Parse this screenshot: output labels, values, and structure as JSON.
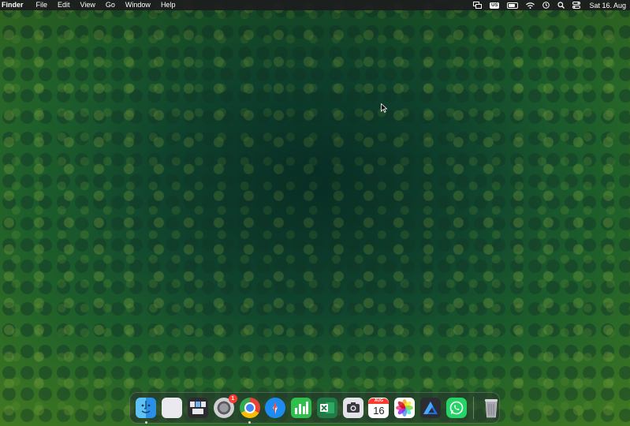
{
  "menubar": {
    "app_name": "Finder",
    "menus": [
      "File",
      "Edit",
      "View",
      "Go",
      "Window",
      "Help"
    ],
    "input_source": "US",
    "clock": "Sat 16. Aug"
  },
  "dock": {
    "items": [
      {
        "name": "Finder",
        "icon": "finder-icon",
        "running": true
      },
      {
        "name": "Launchpad",
        "icon": "launchpad-icon",
        "running": false
      },
      {
        "name": "Mission Control",
        "icon": "mission-control-icon",
        "running": false
      },
      {
        "name": "System Preferences",
        "icon": "system-preferences-icon",
        "running": false,
        "badge": "1"
      },
      {
        "name": "Google Chrome",
        "icon": "chrome-icon",
        "running": true
      },
      {
        "name": "Safari",
        "icon": "safari-icon",
        "running": false
      },
      {
        "name": "Numbers",
        "icon": "numbers-icon",
        "running": false
      },
      {
        "name": "Microsoft Excel",
        "icon": "excel-icon",
        "running": false
      },
      {
        "name": "Screenshot",
        "icon": "screenshot-icon",
        "running": false
      },
      {
        "name": "Calendar",
        "icon": "calendar-icon",
        "running": false,
        "month": "AUG",
        "day": "16"
      },
      {
        "name": "Photos",
        "icon": "photos-icon",
        "running": false
      },
      {
        "name": "Affinity Designer",
        "icon": "affinity-icon",
        "running": false
      },
      {
        "name": "WhatsApp",
        "icon": "whatsapp-icon",
        "running": false
      },
      {
        "name": "Trash",
        "icon": "trash-icon",
        "running": false
      }
    ]
  },
  "colors": {
    "menubar_bg": "#1c1c1e",
    "badge_red": "#ff3b30",
    "wallpaper_dark": "#0e3a2a",
    "wallpaper_light": "#3f7a22"
  }
}
